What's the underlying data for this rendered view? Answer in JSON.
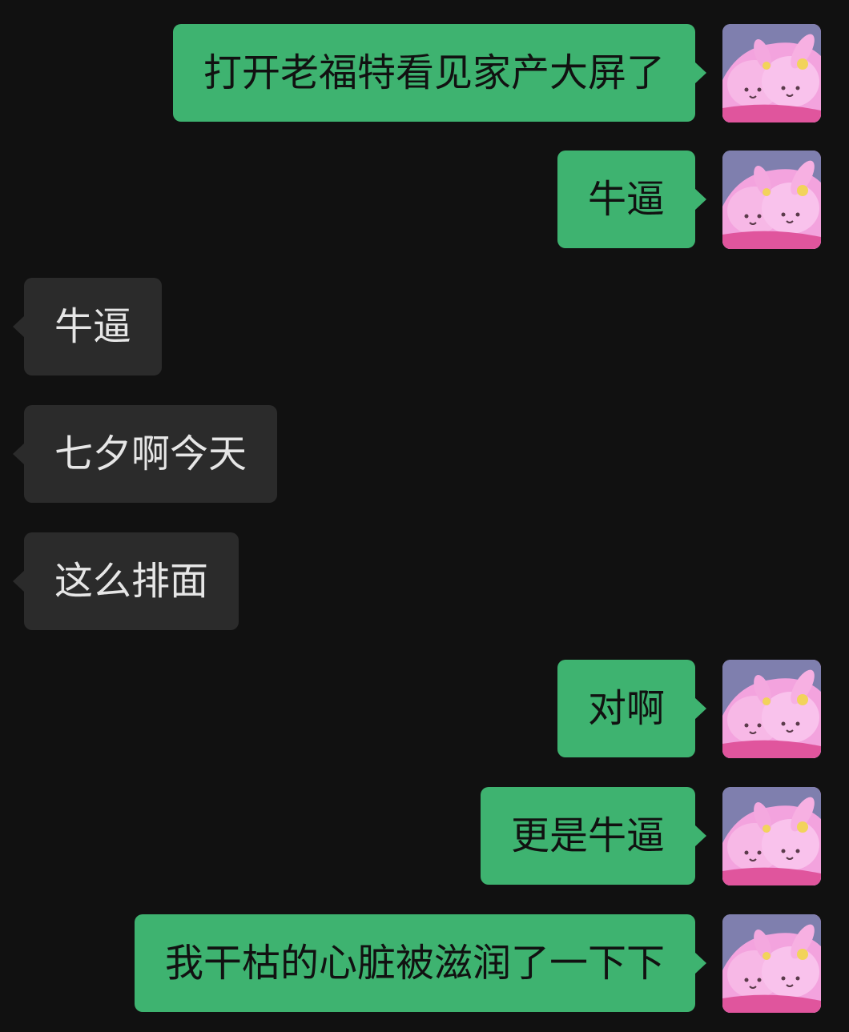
{
  "colors": {
    "background": "#111111",
    "my_bubble": "#3eb370",
    "other_bubble": "#2b2b2b",
    "my_text": "#111111",
    "other_text": "#e6e6e6"
  },
  "messages": [
    {
      "side": "me",
      "text": "打开老福特看见家产大屏了",
      "avatar": "pink-plush-avatar"
    },
    {
      "side": "me",
      "text": "牛逼",
      "avatar": "pink-plush-avatar"
    },
    {
      "side": "other",
      "text": "牛逼"
    },
    {
      "side": "other",
      "text": "七夕啊今天"
    },
    {
      "side": "other",
      "text": "这么排面"
    },
    {
      "side": "me",
      "text": "对啊",
      "avatar": "pink-plush-avatar"
    },
    {
      "side": "me",
      "text": "更是牛逼",
      "avatar": "pink-plush-avatar"
    },
    {
      "side": "me",
      "text": "我干枯的心脏被滋润了一下下",
      "avatar": "pink-plush-avatar"
    }
  ]
}
